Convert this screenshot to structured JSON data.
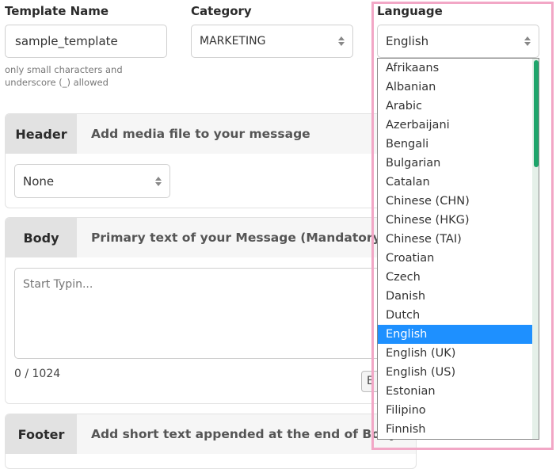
{
  "template_name": {
    "label": "Template Name",
    "value": "sample_template",
    "hint": "only small characters and underscore (_) allowed"
  },
  "category": {
    "label": "Category",
    "value": "MARKETING"
  },
  "language": {
    "label": "Language",
    "value": "English",
    "options": [
      "Afrikaans",
      "Albanian",
      "Arabic",
      "Azerbaijani",
      "Bengali",
      "Bulgarian",
      "Catalan",
      "Chinese (CHN)",
      "Chinese (HKG)",
      "Chinese (TAI)",
      "Croatian",
      "Czech",
      "Danish",
      "Dutch",
      "English",
      "English (UK)",
      "English (US)",
      "Estonian",
      "Filipino",
      "Finnish"
    ],
    "selected_index": 14
  },
  "header_section": {
    "tab": "Header",
    "description": "Add media file to your message",
    "select_value": "None"
  },
  "body_section": {
    "tab": "Body",
    "description": "Primary text of your Message (Mandatory Fi",
    "placeholder": "Start Typin...",
    "counter": "0 / 1024",
    "partial_button": "E"
  },
  "footer_section": {
    "tab": "Footer",
    "description": "Add short text appended at the end of Body"
  },
  "colors": {
    "highlight": "#f2a7c6",
    "selected": "#1e90ff",
    "scrollbar": "#1ea56b"
  }
}
